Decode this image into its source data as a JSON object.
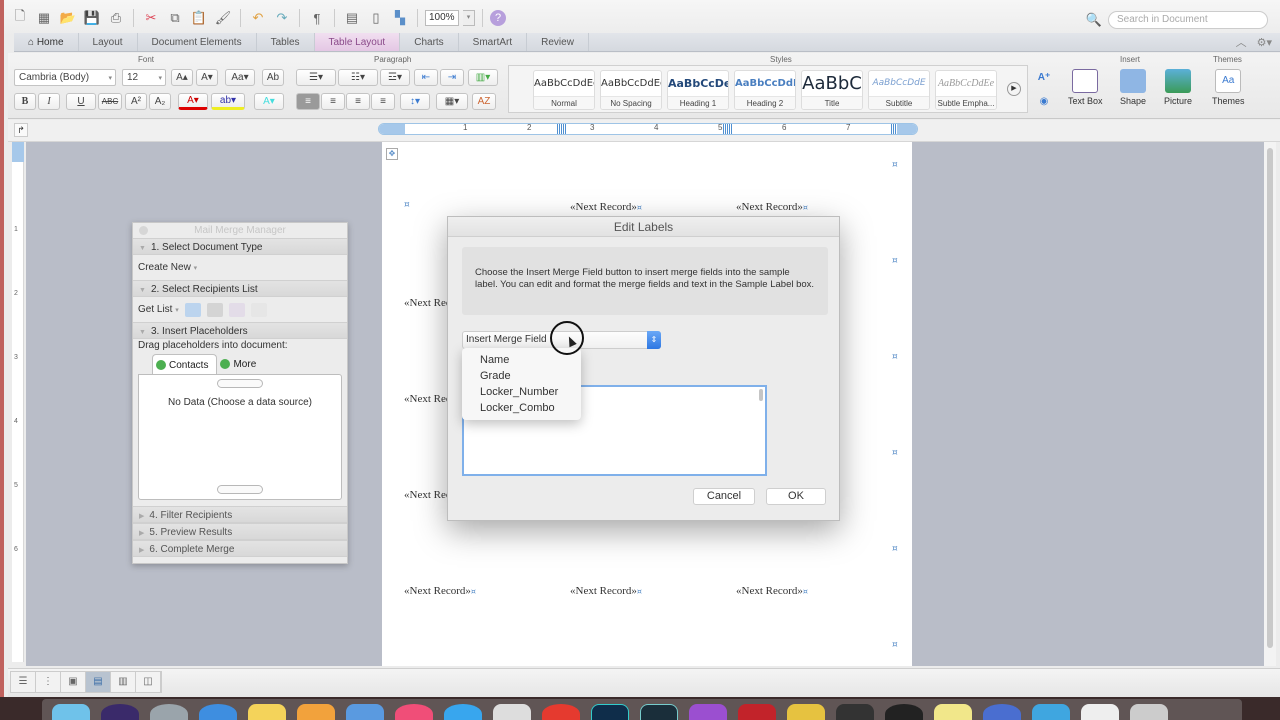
{
  "toolbar": {
    "zoom_level": "100%",
    "search_placeholder": "Search in Document",
    "icons": [
      "new-document-icon",
      "templates-icon",
      "open-icon",
      "save-icon",
      "print-icon",
      "cut-icon",
      "copy-icon",
      "paste-icon",
      "format-painter-icon",
      "undo-icon",
      "redo-icon",
      "pilcrow-icon",
      "sidebar-icon",
      "toolbox-icon",
      "media-browser-icon",
      "help-icon"
    ]
  },
  "ribbon": {
    "tabs": [
      {
        "label": "Home",
        "active": false
      },
      {
        "label": "Layout",
        "active": false
      },
      {
        "label": "Document Elements",
        "active": false
      },
      {
        "label": "Tables",
        "active": false
      },
      {
        "label": "Table Layout",
        "active": true
      },
      {
        "label": "Charts",
        "active": false
      },
      {
        "label": "SmartArt",
        "active": false
      },
      {
        "label": "Review",
        "active": false
      }
    ],
    "groups": {
      "font": "Font",
      "paragraph": "Paragraph",
      "styles": "Styles",
      "insert": "Insert",
      "themes": "Themes"
    },
    "font_name": "Cambria (Body)",
    "font_size": "12",
    "font_buttons": [
      "B",
      "I",
      "U",
      "ABC",
      "A²",
      "A₂"
    ],
    "styles": [
      {
        "sample": "AaBbCcDdEe",
        "name": "Normal"
      },
      {
        "sample": "AaBbCcDdEe",
        "name": "No Spacing"
      },
      {
        "sample": "AaBbCcDe",
        "name": "Heading 1"
      },
      {
        "sample": "AaBbCcDdEe",
        "name": "Heading 2"
      },
      {
        "sample": "AaBbC",
        "name": "Title"
      },
      {
        "sample": "AaBbCcDdE",
        "name": "Subtitle"
      },
      {
        "sample": "AaBbCcDdEe",
        "name": "Subtle Empha..."
      }
    ],
    "insert_buttons": [
      "Text Box",
      "Shape",
      "Picture"
    ],
    "themes_button": "Themes",
    "accent_color": "#e4c7e4"
  },
  "ruler": {
    "h_numbers": [
      "1",
      "2",
      "3",
      "4",
      "5",
      "6",
      "7"
    ],
    "v_numbers": [
      "1",
      "2",
      "3",
      "4",
      "5",
      "6"
    ]
  },
  "document": {
    "merge_field": "«Next Record»",
    "cell_marker": "¤"
  },
  "mail_merge_manager": {
    "title": "Mail Merge Manager",
    "sections": [
      {
        "label": "1. Select Document Type",
        "expanded": true
      },
      {
        "label": "2. Select Recipients List",
        "expanded": true
      },
      {
        "label": "3. Insert Placeholders",
        "expanded": true
      },
      {
        "label": "4. Filter Recipients",
        "expanded": false
      },
      {
        "label": "5. Preview Results",
        "expanded": false
      },
      {
        "label": "6. Complete Merge",
        "expanded": false
      }
    ],
    "create_new": "Create New",
    "get_list": "Get List",
    "drag_hint": "Drag placeholders into document:",
    "tabs": [
      {
        "label": "Contacts",
        "active": true
      },
      {
        "label": "More",
        "active": false
      }
    ],
    "empty_message": "No Data (Choose a data source)"
  },
  "edit_labels": {
    "title": "Edit Labels",
    "instructions": "Choose the Insert Merge Field button to insert merge fields into the sample label.  You can edit and format the merge fields and text in the Sample Label box.",
    "insert_merge_field": "Insert Merge Field",
    "merge_fields": [
      "Name",
      "Grade",
      "Locker_Number",
      "Locker_Combo"
    ],
    "sample_label_value": "",
    "cancel": "Cancel",
    "ok": "OK"
  },
  "dock": {
    "apps": [
      "finder",
      "siri",
      "launchpad",
      "safari",
      "notes",
      "pages",
      "preview",
      "itunes",
      "app-store",
      "system-preferences",
      "chrome",
      "photoshop",
      "lightroom",
      "imovie",
      "app-red",
      "app-color",
      "app-video",
      "app-obs",
      "stickies",
      "app-blue",
      "app-hands",
      "folder",
      "trash"
    ]
  }
}
